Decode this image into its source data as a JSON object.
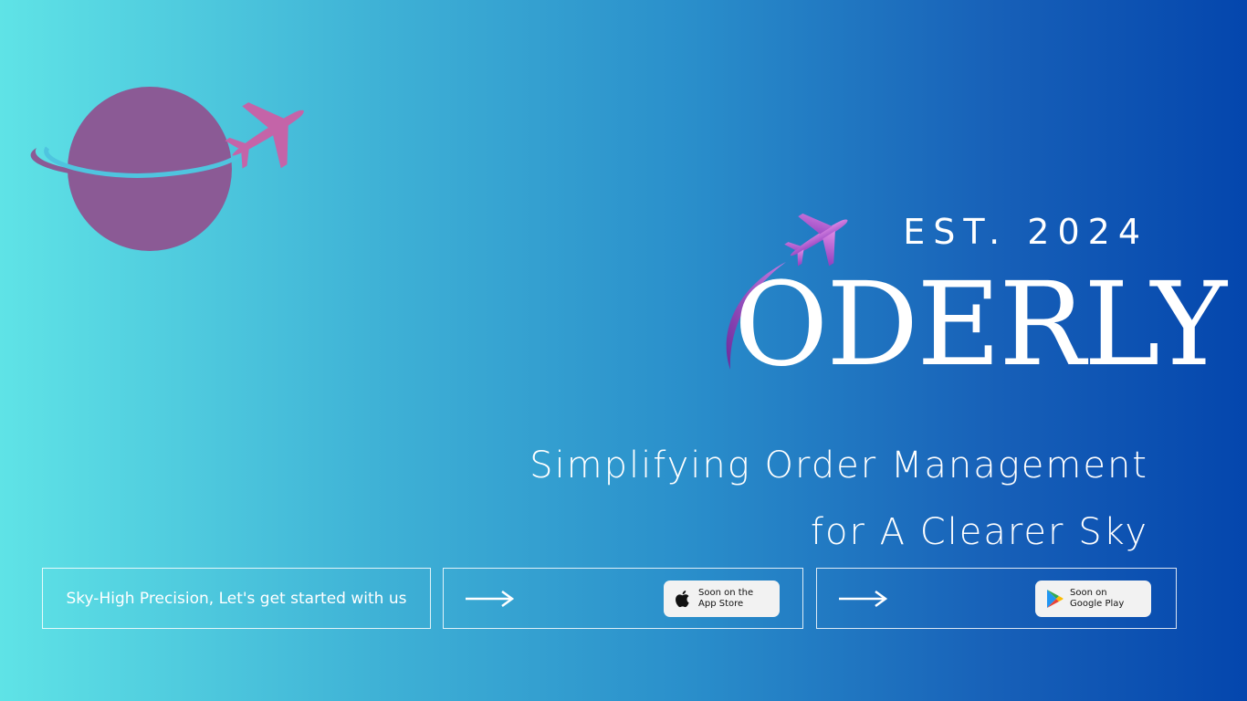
{
  "header": {
    "established": "EST. 2024",
    "brand_name": "ODERLY"
  },
  "tagline": {
    "line1": "Simplifying Order Management",
    "line2": "for A Clearer Sky"
  },
  "cta": {
    "text": "Sky-High Precision, Let's get started with us"
  },
  "stores": {
    "app_store": {
      "line1": "Soon on the",
      "line2": "App Store",
      "icon": "apple-icon"
    },
    "google_play": {
      "line1": "Soon on",
      "line2": "Google Play",
      "icon": "google-play-icon"
    }
  },
  "colors": {
    "background_start": "#5fe3e6",
    "background_end": "#0446ad",
    "globe": "#8b5a95",
    "plane_pink": "#c464a8",
    "brand_plane_purple": "#b45bd4",
    "text": "#ffffff"
  }
}
